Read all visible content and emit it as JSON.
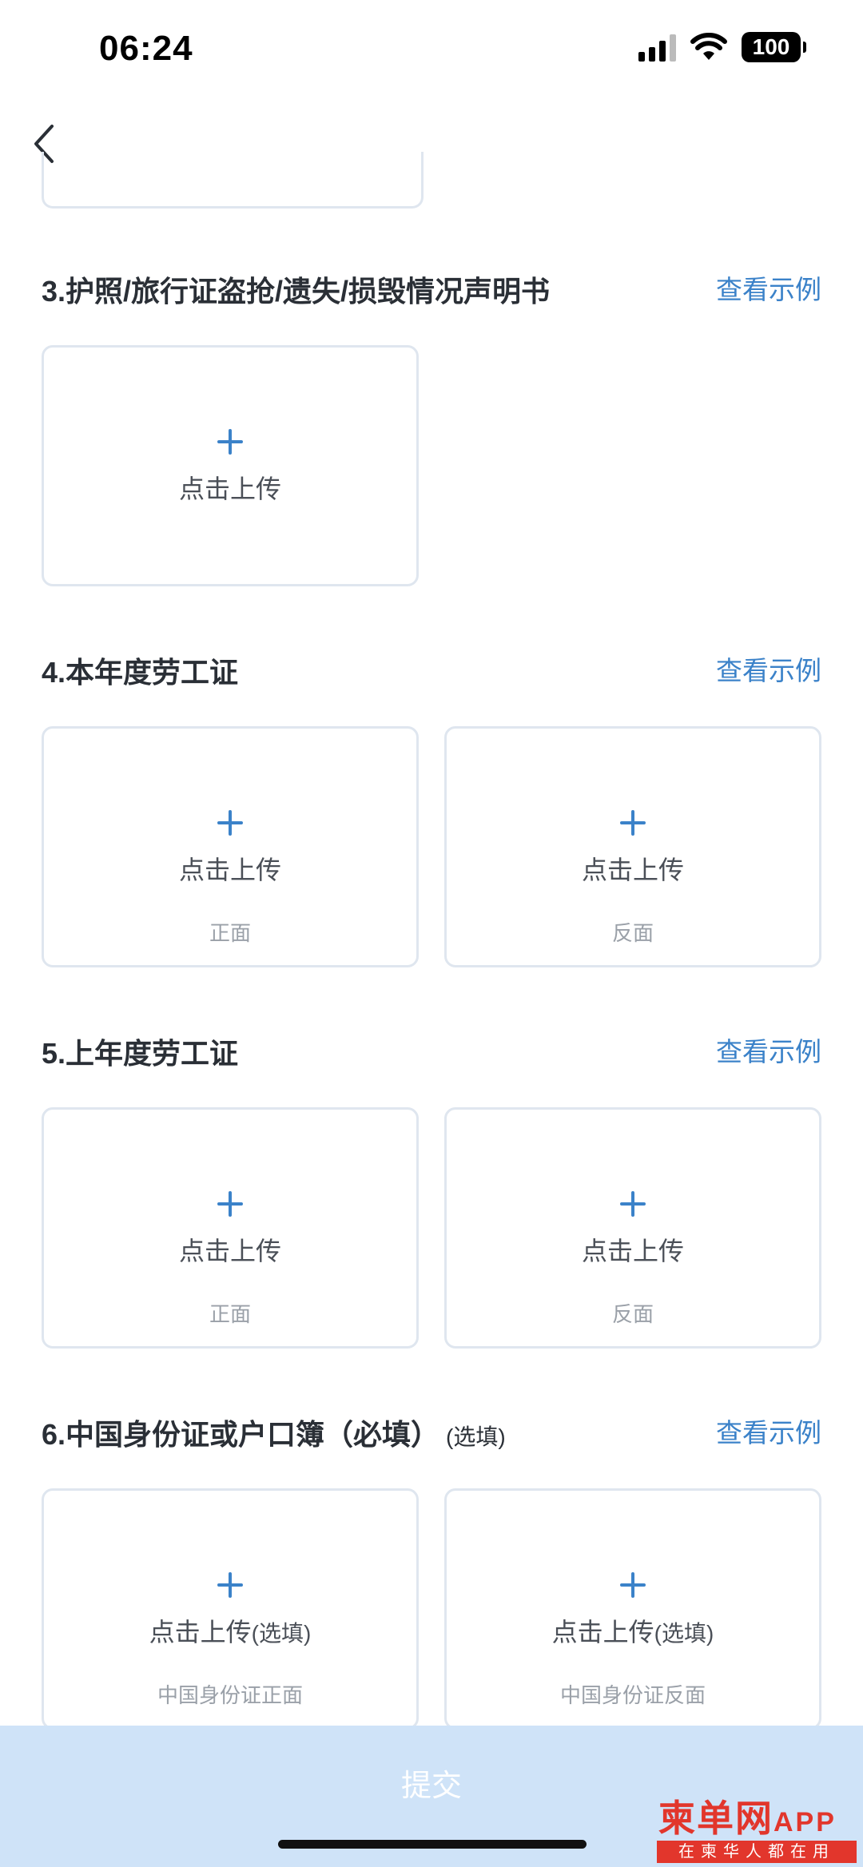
{
  "status_bar": {
    "time": "06:24",
    "battery": "100"
  },
  "nav": {
    "back_icon": "chevron-left-icon"
  },
  "sections": [
    {
      "title": "3.护照/旅行证盗抢/遗失/损毁情况声明书",
      "example_label": "查看示例",
      "cards": [
        {
          "plus": "+",
          "label": "点击上传"
        }
      ]
    },
    {
      "title": "4.本年度劳工证",
      "example_label": "查看示例",
      "cards": [
        {
          "plus": "+",
          "label": "点击上传",
          "sub": "正面"
        },
        {
          "plus": "+",
          "label": "点击上传",
          "sub": "反面"
        }
      ]
    },
    {
      "title": "5.上年度劳工证",
      "example_label": "查看示例",
      "cards": [
        {
          "plus": "+",
          "label": "点击上传",
          "sub": "正面"
        },
        {
          "plus": "+",
          "label": "点击上传",
          "sub": "反面"
        }
      ]
    },
    {
      "title": "6.中国身份证或户口簿（必填）",
      "title_note": "(选填)",
      "example_label": "查看示例",
      "cards": [
        {
          "plus": "+",
          "label": "点击上传",
          "label_note": "(选填)",
          "sub": "中国身份证正面"
        },
        {
          "plus": "+",
          "label": "点击上传",
          "label_note": "(选填)",
          "sub": "中国身份证反面"
        }
      ]
    }
  ],
  "submit": {
    "label": "提交"
  },
  "watermark": {
    "main": "柬单网",
    "app": "APP",
    "slogan": "在柬华人都在用"
  },
  "colors": {
    "accent": "#3b82c9",
    "card_border": "#dfe6ef",
    "submit_bg": "#cfe3f8",
    "watermark": "#e2362c"
  }
}
